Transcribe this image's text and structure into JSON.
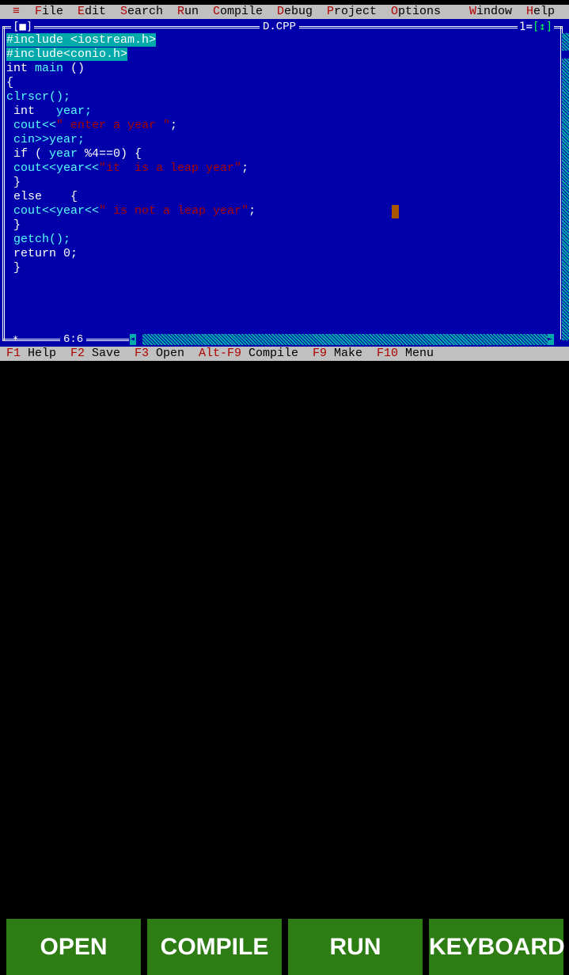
{
  "menu": {
    "system_icon": "≡",
    "items": [
      {
        "hot": "F",
        "rest": "ile"
      },
      {
        "hot": "E",
        "rest": "dit"
      },
      {
        "hot": "S",
        "rest": "earch"
      },
      {
        "hot": "R",
        "rest": "un"
      },
      {
        "hot": "C",
        "rest": "ompile"
      },
      {
        "hot": "D",
        "rest": "ebug"
      },
      {
        "hot": "P",
        "rest": "roject"
      },
      {
        "hot": "O",
        "rest": "ptions"
      },
      {
        "hot": "W",
        "rest": "indow"
      },
      {
        "hot": "H",
        "rest": "elp"
      }
    ]
  },
  "editor": {
    "title": "D.CPP",
    "window_number": "1",
    "close_box": "[■]",
    "zoom_box": "[↕]",
    "cursor_position": "6:6",
    "modified_marker": "*",
    "code": {
      "l1": "#include <iostream.h>",
      "l2": "#include<conio.h>",
      "l3a": "int",
      "l3b": " main ",
      "l3c": "()",
      "l4": "{",
      "l5": "clrscr();",
      "l6a": " int",
      "l6b": "   year;",
      "l7a": " cout<<",
      "l7b": "\" enter a year \"",
      "l7c": ";",
      "l8": " cin>>year;",
      "l9a": " if ( ",
      "l9b": "year",
      "l9c": " %4==0) {",
      "l10a": " cout<<year<<",
      "l10b": "\"it  is a leap year\"",
      "l10c": ";",
      "l11": " }",
      "l12a": " else",
      "l12b": "    {",
      "l13a": " cout<<year<<",
      "l13b": "\" is not a leap year\"",
      "l13c": ";",
      "l14": " }",
      "l15": " getch();",
      "l16a": " return",
      "l16b": " 0;",
      "l17": " }"
    }
  },
  "keybar": [
    {
      "key": "F1",
      "label": " Help"
    },
    {
      "key": "F2",
      "label": " Save"
    },
    {
      "key": "F3",
      "label": " Open"
    },
    {
      "key": "Alt-F9",
      "label": " Compile"
    },
    {
      "key": "F9",
      "label": " Make"
    },
    {
      "key": "F10",
      "label": " Menu"
    }
  ],
  "buttons": {
    "open": "OPEN",
    "compile": "COMPILE",
    "run": "RUN",
    "keyboard": "KEYBOARD"
  },
  "colors": {
    "editor_bg": "#0000aa",
    "button_bg": "#2e7d14",
    "menu_bg": "#c0c0c0",
    "hotkey": "#b00000"
  }
}
